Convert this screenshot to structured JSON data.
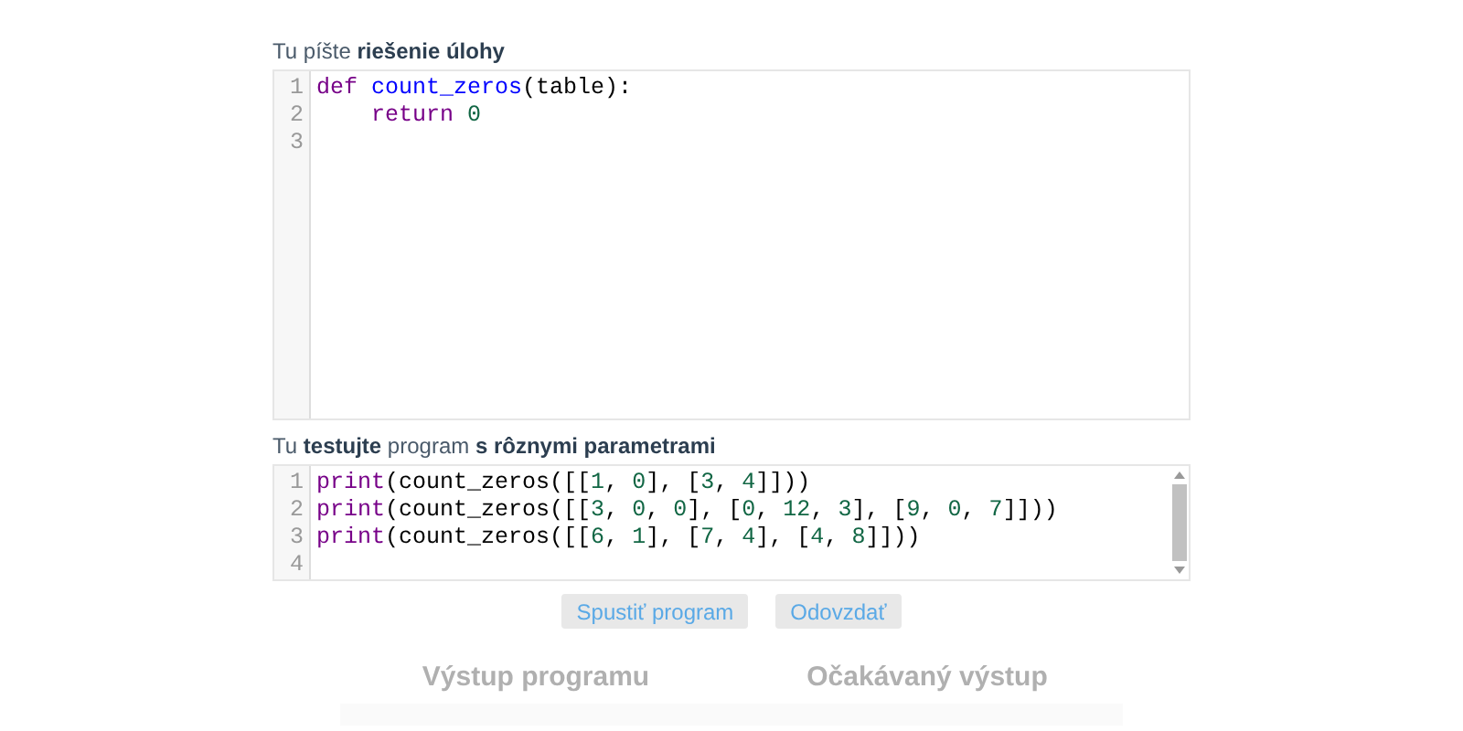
{
  "solution_label": "Tu píšte **riešenie úlohy**",
  "solution_editor": {
    "lines": [
      {
        "number": "1",
        "tokens": [
          {
            "kind": "keyword",
            "text": "def "
          },
          {
            "kind": "function",
            "text": "count_zeros"
          },
          {
            "kind": "plain",
            "text": "(table):"
          }
        ]
      },
      {
        "number": "2",
        "tokens": [
          {
            "kind": "keyword",
            "text": "    return "
          },
          {
            "kind": "number",
            "text": "0"
          }
        ]
      },
      {
        "number": "3"
      }
    ]
  },
  "test_label": "Tu **testujte** program **s rôznymi parametrami**",
  "test_editor": {
    "lines": [
      {
        "number": "1",
        "tokens": [
          {
            "kind": "keyword",
            "text": "print"
          },
          {
            "kind": "plain",
            "text": "(count_zeros([["
          },
          {
            "kind": "number",
            "text": "1"
          },
          {
            "kind": "plain",
            "text": ", "
          },
          {
            "kind": "number",
            "text": "0"
          },
          {
            "kind": "plain",
            "text": "], ["
          },
          {
            "kind": "number",
            "text": "3"
          },
          {
            "kind": "plain",
            "text": ", "
          },
          {
            "kind": "number",
            "text": "4"
          },
          {
            "kind": "plain",
            "text": "]]))"
          }
        ]
      },
      {
        "number": "2",
        "tokens": [
          {
            "kind": "keyword",
            "text": "print"
          },
          {
            "kind": "plain",
            "text": "(count_zeros([["
          },
          {
            "kind": "number",
            "text": "3"
          },
          {
            "kind": "plain",
            "text": ", "
          },
          {
            "kind": "number",
            "text": "0"
          },
          {
            "kind": "plain",
            "text": ", "
          },
          {
            "kind": "number",
            "text": "0"
          },
          {
            "kind": "plain",
            "text": "], ["
          },
          {
            "kind": "number",
            "text": "0"
          },
          {
            "kind": "plain",
            "text": ", "
          },
          {
            "kind": "number",
            "text": "12"
          },
          {
            "kind": "plain",
            "text": ", "
          },
          {
            "kind": "number",
            "text": "3"
          },
          {
            "kind": "plain",
            "text": "], ["
          },
          {
            "kind": "number",
            "text": "9"
          },
          {
            "kind": "plain",
            "text": ", "
          },
          {
            "kind": "number",
            "text": "0"
          },
          {
            "kind": "plain",
            "text": ", "
          },
          {
            "kind": "number",
            "text": "7"
          },
          {
            "kind": "plain",
            "text": "]]))"
          }
        ]
      },
      {
        "number": "3",
        "tokens": [
          {
            "kind": "keyword",
            "text": "print"
          },
          {
            "kind": "plain",
            "text": "(count_zeros([["
          },
          {
            "kind": "number",
            "text": "6"
          },
          {
            "kind": "plain",
            "text": ", "
          },
          {
            "kind": "number",
            "text": "1"
          },
          {
            "kind": "plain",
            "text": "], ["
          },
          {
            "kind": "number",
            "text": "7"
          },
          {
            "kind": "plain",
            "text": ", "
          },
          {
            "kind": "number",
            "text": "4"
          },
          {
            "kind": "plain",
            "text": "], ["
          },
          {
            "kind": "number",
            "text": "4"
          },
          {
            "kind": "plain",
            "text": ", "
          },
          {
            "kind": "number",
            "text": "8"
          },
          {
            "kind": "plain",
            "text": "]]))"
          }
        ]
      },
      {
        "number": "4"
      }
    ]
  },
  "buttons": [
    "Spustiť program",
    "Odovzdať"
  ],
  "outputs": [
    {
      "title": "Výstup programu"
    },
    {
      "title": "Očakávaný výstup"
    }
  ]
}
